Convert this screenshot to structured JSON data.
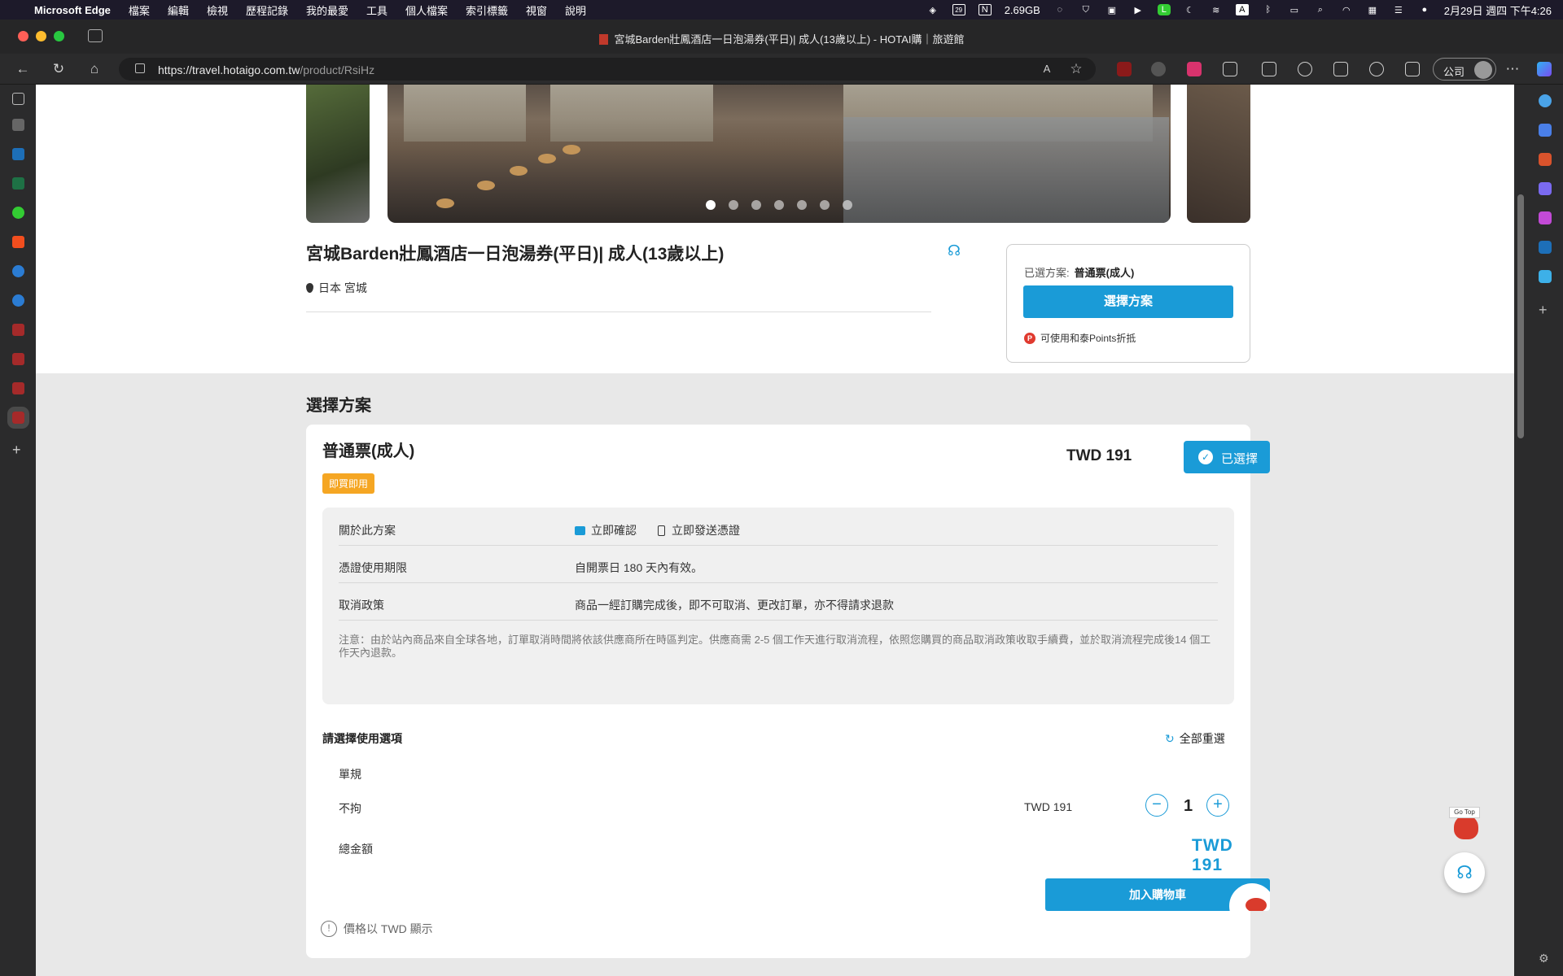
{
  "menubar": {
    "app": "Microsoft Edge",
    "menus": [
      "檔案",
      "編輯",
      "檢視",
      "歷程記錄",
      "我的最愛",
      "工具",
      "個人檔案",
      "索引標籤",
      "視窗",
      "說明"
    ],
    "memory": "2.69GB",
    "calendar_badge": "29",
    "datetime": "2月29日 週四 下午4:26"
  },
  "browser": {
    "tab_title": "宮城Barden壯鳳酒店一日泡湯券(平日)| 成人(13歲以上) - HOTAI購｜旅遊館",
    "url_domain": "https://travel.hotaigo.com.tw",
    "url_path": "/product/RsiHz",
    "profile_label": "公司"
  },
  "product": {
    "title": "宮城Barden壯鳳酒店一日泡湯券(平日)| 成人(13歲以上)",
    "location": "日本 宮城",
    "carousel_dots": 7,
    "carousel_active": 0
  },
  "selection_card": {
    "label": "已選方案:",
    "selected_plan": "普通票(成人)",
    "button": "選擇方案",
    "points_badge": "P",
    "points_text": "可使用和泰Points折抵"
  },
  "plans_section": {
    "title": "選擇方案",
    "plan": {
      "name": "普通票(成人)",
      "badge": "即買即用",
      "price": "TWD 191",
      "selected_label": "已選擇",
      "about_label": "關於此方案",
      "about_items": [
        "立即確認",
        "立即發送憑證"
      ],
      "validity_label": "憑證使用期限",
      "validity_value": "自開票日 180 天內有效。",
      "cancel_label": "取消政策",
      "cancel_value": "商品一經訂購完成後，即不可取消、更改訂單，亦不得請求退款",
      "note": "注意：由於站內商品來自全球各地，訂單取消時間將依該供應商所在時區判定。供應商需 2-5 個工作天進行取消流程，依照您購買的商品取消政策收取手續費，並於取消流程完成後14 個工作天內退款。"
    },
    "options_title": "請選擇使用選項",
    "reset_label": "全部重選",
    "spec_label": "單規",
    "option_name": "不拘",
    "option_price": "TWD 191",
    "quantity": "1",
    "total_label": "總金額",
    "total_value": "TWD 191",
    "cart_button": "加入購物車",
    "price_note": "價格以 TWD 顯示"
  },
  "floating": {
    "gotop_label": "Go Top"
  },
  "colors": {
    "accent": "#1a9bd7",
    "badge_orange": "#f5a623",
    "points_red": "#e03a2f",
    "section_gray": "#e8e8e8"
  }
}
